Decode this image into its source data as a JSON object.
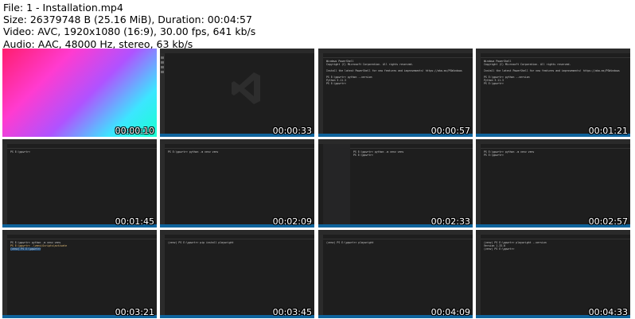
{
  "header": {
    "file": "File: 1 - Installation.mp4",
    "size": "Size: 26379748 B (25.16 MiB), Duration: 00:04:57",
    "video": "Video: AVC, 1920x1080 (16:9), 30.00 fps, 641 kb/s",
    "audio": "Audio: AAC, 48000 Hz, stereo, 63 kb/s"
  },
  "thumbnails": [
    {
      "timestamp": "00:00:10"
    },
    {
      "timestamp": "00:00:33"
    },
    {
      "timestamp": "00:00:57"
    },
    {
      "timestamp": "00:01:21"
    },
    {
      "timestamp": "00:01:45"
    },
    {
      "timestamp": "00:02:09"
    },
    {
      "timestamp": "00:02:33"
    },
    {
      "timestamp": "00:02:57"
    },
    {
      "timestamp": "00:03:21"
    },
    {
      "timestamp": "00:03:45"
    },
    {
      "timestamp": "00:04:09"
    },
    {
      "timestamp": "00:04:33"
    }
  ],
  "terminal": {
    "ps_header": "Windows PowerShell",
    "copyright": "Copyright (C) Microsoft Corporation. All rights reserved.",
    "install_hint": "Install the latest PowerShell for new features and improvements! https://aka.ms/PSWindows",
    "prompt_python": "PS E:\\ppwrtr> python --version",
    "python_version": "Python 3.11.3",
    "prompt": "PS E:\\ppwrtr>",
    "cmd_venv": "PS E:\\ppwrtr> python -m venv venv",
    "cmd_activate": "PS E:\\ppwrtr> .\\venv\\Scripts\\activate",
    "venv_prompt": "(venv) PS E:\\ppwrtr>",
    "cmd_pip": "(venv) PS E:\\ppwrtr> pip install playwright",
    "cmd_pw": "(venv) PS E:\\ppwrtr> playwright",
    "cmd_pw_version": "(venv) PS E:\\ppwrtr> playwright --version",
    "pw_version": "Version 1.33.0"
  }
}
